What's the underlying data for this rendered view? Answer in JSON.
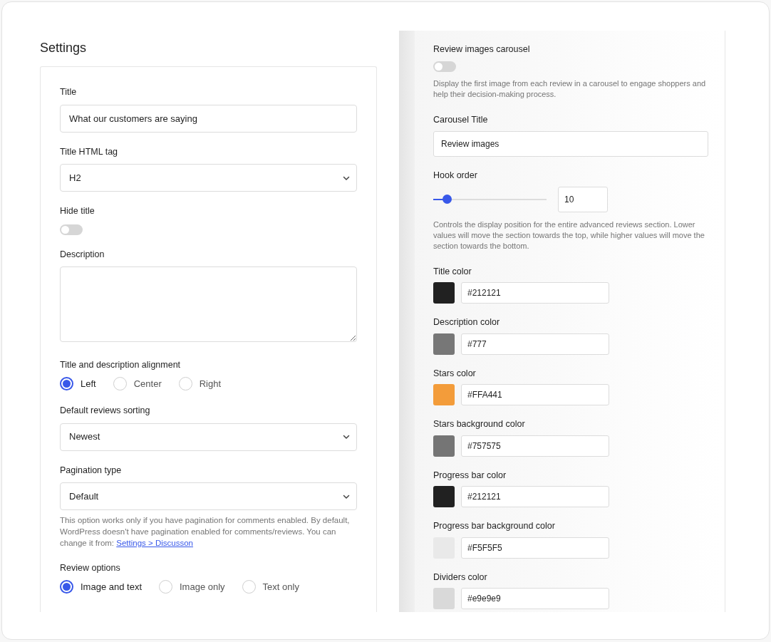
{
  "heading": "Settings",
  "left_fields": [
    {
      "kind": "text",
      "label": "Title",
      "value": "What our customers are saying"
    },
    {
      "kind": "select",
      "label": "Title HTML tag",
      "value": "H2"
    },
    {
      "kind": "toggle",
      "label": "Hide title",
      "on": false
    },
    {
      "kind": "textarea",
      "label": "Description"
    },
    {
      "kind": "radio",
      "label": "Title and description alignment",
      "options": [
        {
          "label": "Left",
          "selected": true
        },
        {
          "label": "Center",
          "selected": false
        },
        {
          "label": "Right",
          "selected": false
        }
      ]
    },
    {
      "kind": "select",
      "label": "Default reviews sorting",
      "value": "Newest"
    },
    {
      "kind": "select",
      "label": "Pagination type",
      "value": "Default",
      "help": "This option works only if you have pagination for comments enabled. By default, WordPress doesn't have pagination enabled for comments/reviews. You can change it from:",
      "help_link": "Settings > Discusson"
    },
    {
      "kind": "radio",
      "label": "Review options",
      "options": [
        {
          "label": "Image and text",
          "selected": true
        },
        {
          "label": "Image only",
          "selected": false
        },
        {
          "label": "Text only",
          "selected": false
        }
      ]
    }
  ],
  "right_fields": [
    {
      "kind": "toggle",
      "label": "Review images carousel",
      "on": false,
      "help": "Display the first image from each review in a carousel to engage shoppers and help their decision-making process."
    },
    {
      "kind": "text",
      "label": "Carousel Title",
      "value": "Review images"
    },
    {
      "kind": "slider",
      "label": "Hook order",
      "level": 0.12,
      "value": "10",
      "help": "Controls the display position for the entire advanced reviews section. Lower values will move the section towards the top, while higher values will move the section towards the bottom."
    },
    {
      "kind": "color",
      "label": "Title color",
      "value": "#212121",
      "color": "#212121"
    },
    {
      "kind": "color",
      "label": "Description color",
      "value": "#777",
      "color": "#777777"
    },
    {
      "kind": "color",
      "label": "Stars color",
      "value": "#FFA441",
      "color": "#f39c3a"
    },
    {
      "kind": "color",
      "label": "Stars background color",
      "value": "#757575",
      "color": "#757575"
    },
    {
      "kind": "color",
      "label": "Progress bar color",
      "value": "#212121",
      "color": "#212121"
    },
    {
      "kind": "color",
      "label": "Progress bar background color",
      "value": "#F5F5F5",
      "color": "#e9e9e9"
    },
    {
      "kind": "color",
      "label": "Dividers color",
      "value": "#e9e9e9",
      "color": "#d9d9d9"
    }
  ]
}
